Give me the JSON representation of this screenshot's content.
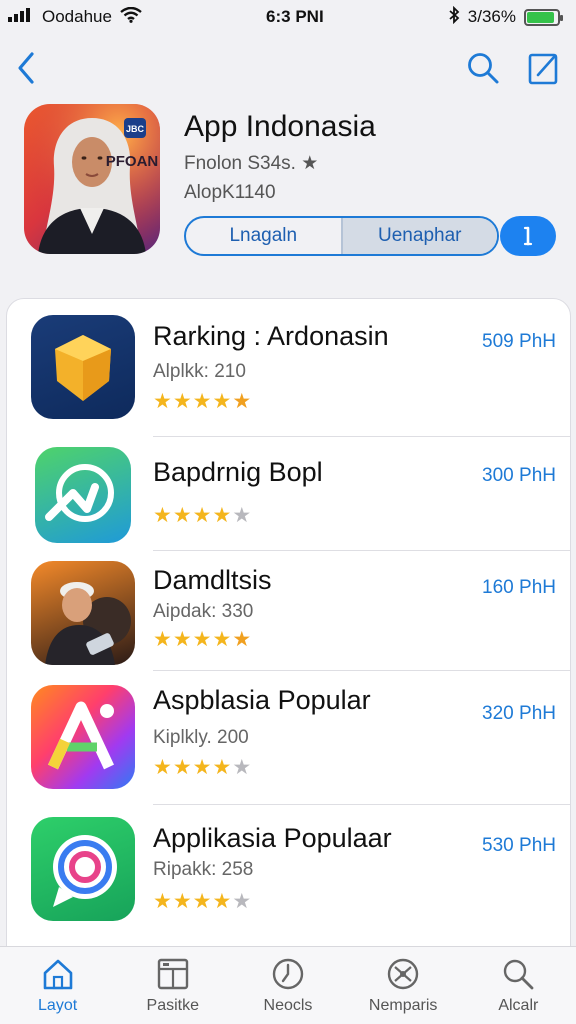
{
  "status_bar": {
    "carrier": "Oodahue",
    "time": "6:3 PNI",
    "battery_text": "3/36%",
    "battery_level": 0.9
  },
  "header": {
    "title": "App Indonasia",
    "subtitle": "Fnolon S34s. ★",
    "subtitle2": "AlopK1140",
    "segment": [
      "Lnagaln",
      "Uenaphar"
    ],
    "active_segment": 1,
    "icon_badge": "PFOAN"
  },
  "apps": [
    {
      "title": "Rarking : Ardonasin",
      "subtitle": "Alplkk: 210",
      "rating": 4.5,
      "price": "509 PhH",
      "icon": "yellow-cube-icon"
    },
    {
      "title": "Bapdrnig Bopl",
      "subtitle": "",
      "rating": 4,
      "price": "300 PhH",
      "icon": "green-phone-arrow-icon"
    },
    {
      "title": "Damdltsis",
      "subtitle": "Aipdak: 330",
      "rating": 4.5,
      "price": "160 PhH",
      "icon": "man-portrait-icon"
    },
    {
      "title": "Aspblasia Popular",
      "subtitle": "Kiplkly. 200",
      "rating": 4,
      "price": "320 PhH",
      "icon": "gradient-a-letter-icon"
    },
    {
      "title": "Applikasia Populaar",
      "subtitle": "Ripakk: 258",
      "rating": 4,
      "price": "530 PhH",
      "icon": "chat-bubble-icon"
    }
  ],
  "tabs": [
    {
      "label": "Layot",
      "icon": "home-icon",
      "active": true
    },
    {
      "label": "Pasitke",
      "icon": "grid-icon",
      "active": false
    },
    {
      "label": "Neocls",
      "icon": "clock-icon",
      "active": false
    },
    {
      "label": "Nemparis",
      "icon": "compass-icon",
      "active": false
    },
    {
      "label": "Alcalr",
      "icon": "search-icon",
      "active": false
    }
  ],
  "colors": {
    "accent": "#1e7ad6",
    "star": "#f4b51d",
    "background": "#f1f1f4"
  }
}
